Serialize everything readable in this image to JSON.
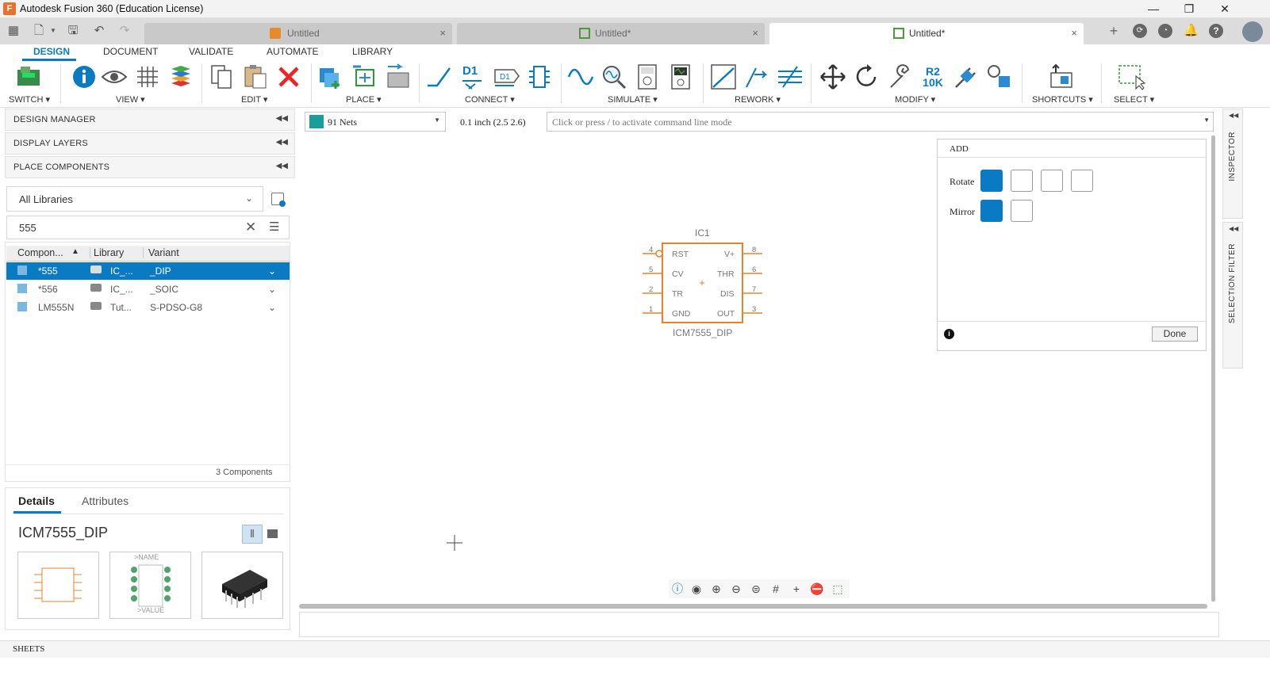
{
  "window": {
    "app_icon": "F",
    "title": "Autodesk Fusion 360 (Education License)",
    "controls": [
      "—",
      "❐",
      "✕"
    ]
  },
  "doc_tabs": [
    {
      "label": "Untitled",
      "icon": "cube-icon",
      "close": "×"
    },
    {
      "label": "Untitled*",
      "icon": "board-icon",
      "close": "×"
    },
    {
      "label": "Untitled*",
      "icon": "schematic-icon",
      "close": "×"
    }
  ],
  "ribbon": {
    "tabs": [
      "DESIGN",
      "DOCUMENT",
      "VALIDATE",
      "AUTOMATE",
      "LIBRARY"
    ],
    "groups": [
      "SWITCH ▾",
      "VIEW ▾",
      "EDIT ▾",
      "PLACE ▾",
      "CONNECT ▾",
      "SIMULATE ▾",
      "REWORK ▾",
      "MODIFY ▾",
      "SHORTCUTS ▾",
      "SELECT ▾"
    ],
    "connect_net_label": "D1",
    "modify_value_label": "R2",
    "modify_value": "10K"
  },
  "left_panel": {
    "headers": [
      "DESIGN MANAGER",
      "DISPLAY LAYERS",
      "PLACE COMPONENTS"
    ],
    "collapse_glyph": "◀◀",
    "library_select": "All Libraries",
    "search_value": "555",
    "columns": [
      "Compon...",
      "Library",
      "Variant"
    ],
    "rows": [
      {
        "name": "*555",
        "library": "IC_...",
        "variant": "_DIP"
      },
      {
        "name": "*556",
        "library": "IC_...",
        "variant": "_SOIC"
      },
      {
        "name": "LM555N",
        "library": "Tut...",
        "variant": "S-PDSO-G8"
      }
    ],
    "count": "3 Components",
    "details_tabs": [
      "Details",
      "Attributes"
    ],
    "part_name": "ICM7555_DIP",
    "thumb_name": ">NAME",
    "thumb_value": ">VALUE"
  },
  "command_bar": {
    "net_select": "91 Nets",
    "grid": "0.1 inch (2.5 2.6)",
    "command_placeholder": "Click or press / to activate command line mode"
  },
  "schematic": {
    "ref": "IC1",
    "value": "ICM7555_DIP",
    "pins_left": [
      {
        "num": "4",
        "name": "RST"
      },
      {
        "num": "5",
        "name": "CV"
      },
      {
        "num": "2",
        "name": "TR"
      },
      {
        "num": "1",
        "name": "GND"
      }
    ],
    "pins_right": [
      {
        "num": "8",
        "name": "V+"
      },
      {
        "num": "6",
        "name": "THR"
      },
      {
        "num": "7",
        "name": "DIS"
      },
      {
        "num": "3",
        "name": "OUT"
      }
    ]
  },
  "add_panel": {
    "title": "ADD",
    "rotate_label": "Rotate",
    "mirror_label": "Mirror",
    "done": "Done"
  },
  "side_tabs": [
    "INSPECTOR",
    "SELECTION FILTER"
  ],
  "sheets_label": "SHEETS",
  "colors": {
    "accent": "#0a7bc2",
    "symbol": "#e8822c",
    "net_swatch": "#1a9e9a"
  }
}
